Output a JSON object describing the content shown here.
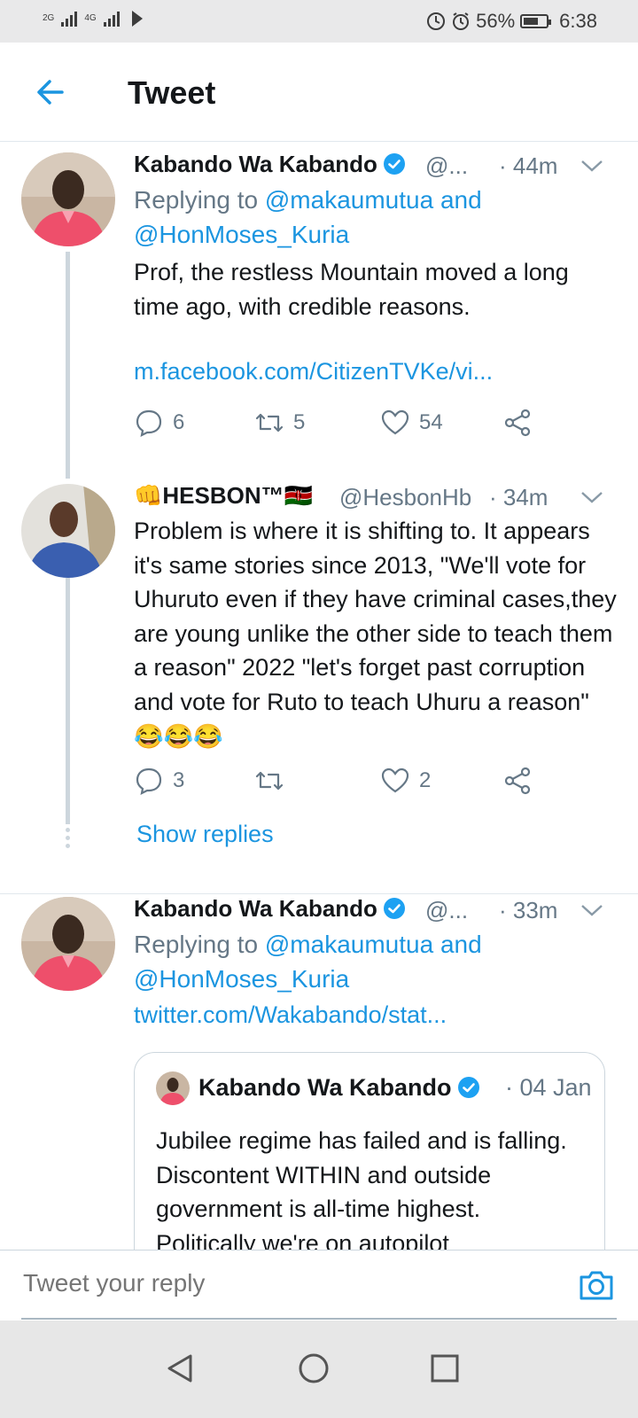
{
  "status_bar": {
    "sim1": "2G",
    "sim2": "4G",
    "battery": "56%",
    "time": "6:38"
  },
  "header": {
    "title": "Tweet",
    "back_icon": "arrow-left-icon"
  },
  "tweets": [
    {
      "name": "Kabando Wa Kabando",
      "verified": true,
      "handle": "@...",
      "time": "· 44m",
      "replying_prefix": "Replying to",
      "replying_to": "@makaumutua and @HonMoses_Kuria",
      "text": "Prof, the restless Mountain moved a long time ago, with credible reasons.",
      "link": "m.facebook.com/CitizenTVKe/vi...",
      "replies": "6",
      "retweets": "5",
      "likes": "54"
    },
    {
      "name": "👊HESBON™🇰🇪",
      "handle": "@HesbonHb",
      "time": "· 34m",
      "text": "Problem is where it is shifting to. It appears it's same stories since 2013, \"We'll vote for Uhuruto even if they have criminal cases,they are young unlike the other side to teach them a reason\" 2022 \"let's forget past corruption and vote for Ruto to teach Uhuru a reason\" 😂😂😂",
      "replies": "3",
      "retweets": "",
      "likes": "2",
      "show_replies": "Show replies"
    },
    {
      "name": "Kabando Wa Kabando",
      "verified": true,
      "handle": "@...",
      "time": "· 33m",
      "replying_prefix": "Replying to",
      "replying_to": "@makaumutua and @HonMoses_Kuria",
      "link": "twitter.com/Wakabando/stat...",
      "quote": {
        "name": "Kabando Wa Kabando",
        "time": "· 04 Jan",
        "text": "Jubilee regime has failed and is falling. Discontent WITHIN and outside government is all-time highest. Politically we're on autopilot"
      }
    }
  ],
  "composer": {
    "placeholder": "Tweet your reply",
    "camera_icon": "camera-icon"
  },
  "colors": {
    "accent": "#1b95e0",
    "secondary_text": "#657786",
    "verified": "#1da1f2"
  }
}
